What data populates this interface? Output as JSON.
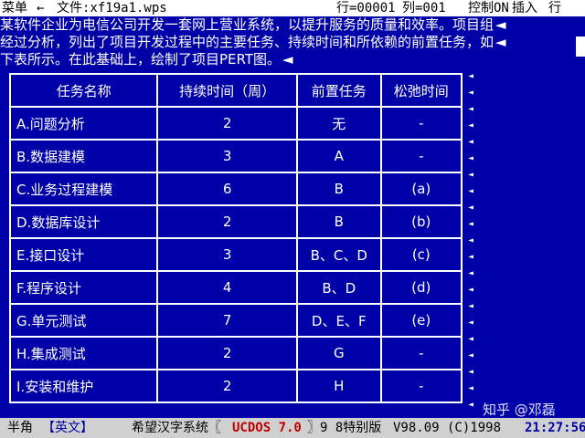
{
  "topbar": {
    "menu": "菜单",
    "arrow": "←",
    "file_label": "文件:xf19a1.wps",
    "row": "行=00001",
    "col": "列=001",
    "control": "控制ON",
    "insert": "插入",
    "row_mode": "行"
  },
  "paragraph": [
    "某软件企业为电信公司开发一套网上营业系统，以提升服务的质量和效率。项目组",
    "经过分析，列出了项目开发过程中的主要任务、持续时间和所依赖的前置任务，如",
    "下表所示。在此基础上，绘制了项目PERT图。"
  ],
  "table": {
    "headers": [
      "任务名称",
      "持续时间（周）",
      "前置任务",
      "松弛时间"
    ],
    "rows": [
      [
        "A.问题分析",
        "2",
        "无",
        "-"
      ],
      [
        "B.数据建模",
        "3",
        "A",
        "-"
      ],
      [
        "C.业务过程建模",
        "6",
        "B",
        "(a)"
      ],
      [
        "D.数据库设计",
        "2",
        "B",
        "(b)"
      ],
      [
        "E.接口设计",
        "3",
        "B、C、D",
        "(c)"
      ],
      [
        "F.程序设计",
        "4",
        "B、D",
        "(d)"
      ],
      [
        "G.单元测试",
        "7",
        "D、E、F",
        "(e)"
      ],
      [
        "H.集成测试",
        "2",
        "G",
        "-"
      ],
      [
        "I.安装和维护",
        "2",
        "H",
        "-"
      ]
    ]
  },
  "statusbar": {
    "mode": "半角",
    "lang": "【英文】",
    "system": "希望汉字系统〖",
    "product": "UCDOS 7.0",
    "edition": "〗9 8特别版",
    "version": "V98.09 (C)1998",
    "time": "21:27:56"
  },
  "watermark": "知乎 @邓磊"
}
